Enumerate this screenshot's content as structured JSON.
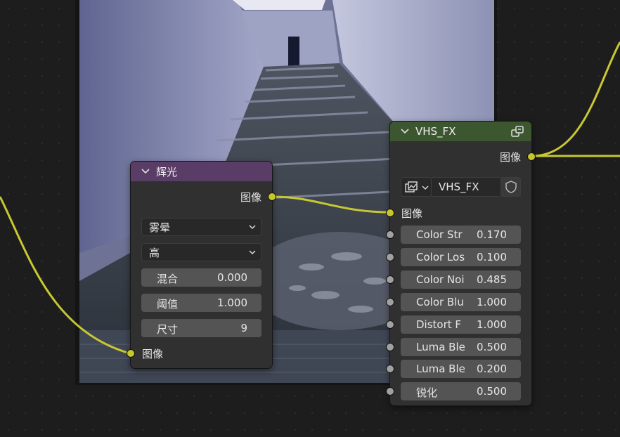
{
  "glare_node": {
    "title": "辉光",
    "output_label": "图像",
    "glare_type": "雾晕",
    "quality": "高",
    "fields": [
      {
        "label": "混合",
        "value": "0.000"
      },
      {
        "label": "阈值",
        "value": "1.000"
      },
      {
        "label": "尺寸",
        "value": "9"
      }
    ],
    "input_label": "图像"
  },
  "vhs_node": {
    "title": "VHS_FX",
    "output_label": "图像",
    "group_name": "VHS_FX",
    "input_label": "图像",
    "fields": [
      {
        "label": "Color Str",
        "value": "0.170"
      },
      {
        "label": "Color Los",
        "value": "0.100"
      },
      {
        "label": "Color Noi",
        "value": "0.485"
      },
      {
        "label": "Color Blu",
        "value": "1.000"
      },
      {
        "label": "Distort F",
        "value": "1.000"
      },
      {
        "label": "Luma Ble",
        "value": "0.500"
      },
      {
        "label": "Luma Ble",
        "value": "0.200"
      },
      {
        "label": "锐化",
        "value": "0.500"
      }
    ]
  },
  "colors": {
    "editor_bg": "#1d1d1d",
    "node_body": "#303030",
    "glare_header": "#5a3d66",
    "group_header": "#3c5630",
    "image_socket": "#c7c729",
    "value_socket": "#a1a1a1",
    "link": "#c8c832"
  }
}
